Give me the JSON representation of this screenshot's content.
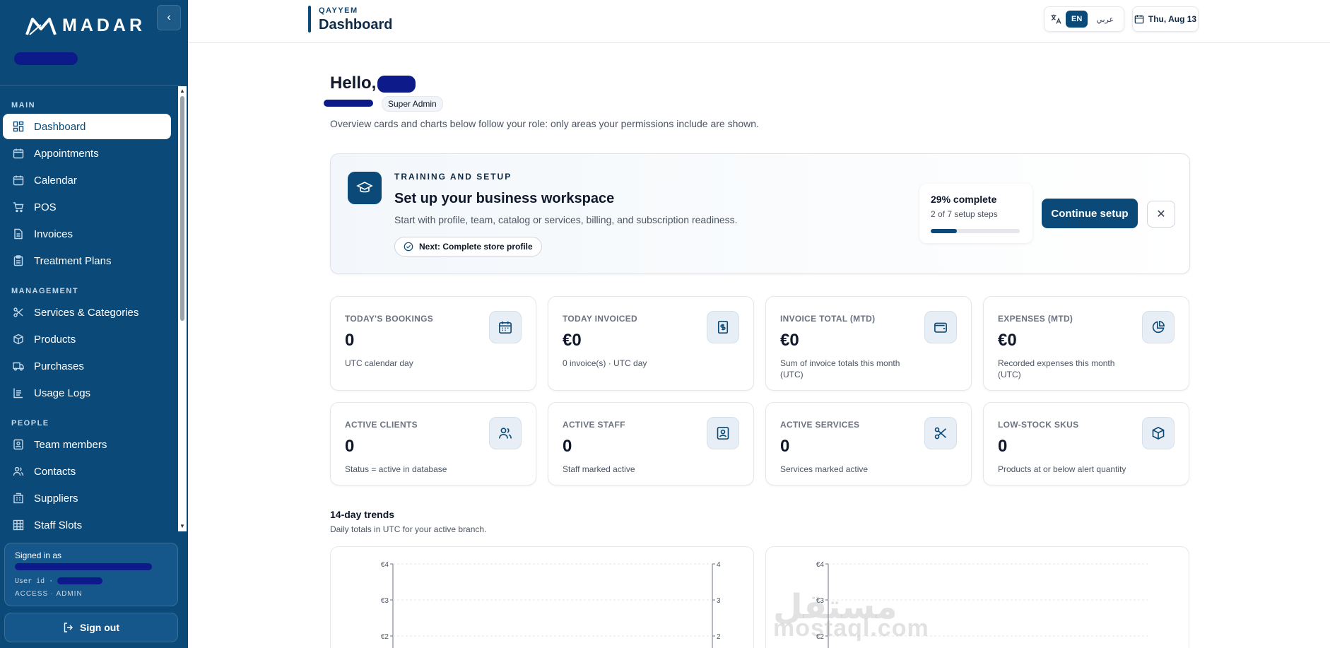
{
  "brand": {
    "logo_text": "MADAR"
  },
  "sidebar": {
    "sections": [
      {
        "label": "MAIN",
        "items": [
          {
            "label": "Dashboard",
            "icon": "dashboard-icon",
            "active": true
          },
          {
            "label": "Appointments",
            "icon": "calendar-icon"
          },
          {
            "label": "Calendar",
            "icon": "calendar-icon"
          },
          {
            "label": "POS",
            "icon": "cart-icon"
          },
          {
            "label": "Invoices",
            "icon": "file-icon"
          },
          {
            "label": "Treatment Plans",
            "icon": "clipboard-icon"
          }
        ]
      },
      {
        "label": "MANAGEMENT",
        "items": [
          {
            "label": "Services & Categories",
            "icon": "scissors-icon"
          },
          {
            "label": "Products",
            "icon": "box-icon"
          },
          {
            "label": "Purchases",
            "icon": "truck-icon"
          },
          {
            "label": "Usage Logs",
            "icon": "log-icon"
          }
        ]
      },
      {
        "label": "PEOPLE",
        "items": [
          {
            "label": "Team members",
            "icon": "id-badge-icon"
          },
          {
            "label": "Contacts",
            "icon": "users-icon"
          },
          {
            "label": "Suppliers",
            "icon": "building-icon"
          },
          {
            "label": "Staff Slots",
            "icon": "grid-icon"
          }
        ]
      }
    ],
    "signed_in": {
      "title": "Signed in as",
      "user_id_label": "User id ·",
      "access": "ACCESS · ADMIN"
    },
    "sign_out": "Sign out"
  },
  "header": {
    "brand": "QAYYEM",
    "title": "Dashboard",
    "lang_en": "EN",
    "lang_ar": "عربي",
    "date": "Thu, Aug 13"
  },
  "main": {
    "hello": "Hello,",
    "role": "Super Admin",
    "overview": "Overview cards and charts below follow your role: only areas your permissions include are shown."
  },
  "setup": {
    "eyebrow": "TRAINING AND SETUP",
    "title": "Set up your business workspace",
    "desc": "Start with profile, team, catalog or services, billing, and subscription readiness.",
    "next": "Next: Complete store profile",
    "percent_label": "29% complete",
    "progress": 0.29,
    "steps": "2 of 7 setup steps",
    "continue": "Continue setup"
  },
  "stats": [
    {
      "label": "TODAY'S BOOKINGS",
      "value": "0",
      "note": "UTC calendar day",
      "icon": "calendar-icon"
    },
    {
      "label": "TODAY INVOICED",
      "value": "€0",
      "note": "0 invoice(s) · UTC day",
      "icon": "dollar-doc-icon"
    },
    {
      "label": "INVOICE TOTAL (MTD)",
      "value": "€0",
      "note": "Sum of invoice totals this month (UTC)",
      "icon": "wallet-icon"
    },
    {
      "label": "EXPENSES (MTD)",
      "value": "€0",
      "note": "Recorded expenses this month (UTC)",
      "icon": "pie-chart-icon"
    },
    {
      "label": "ACTIVE CLIENTS",
      "value": "0",
      "note": "Status = active in database",
      "icon": "users-icon"
    },
    {
      "label": "ACTIVE STAFF",
      "value": "0",
      "note": "Staff marked active",
      "icon": "id-badge-icon"
    },
    {
      "label": "ACTIVE SERVICES",
      "value": "0",
      "note": "Services marked active",
      "icon": "scissors-icon"
    },
    {
      "label": "LOW-STOCK SKUS",
      "value": "0",
      "note": "Products at or below alert quantity",
      "icon": "box-icon"
    }
  ],
  "trends": {
    "title": "14-day trends",
    "subtitle": "Daily totals in UTC for your active branch."
  },
  "chart_data": [
    {
      "type": "line",
      "yticks_left": [
        "€4",
        "€3",
        "€2"
      ],
      "yticks_right": [
        "4",
        "3",
        "2"
      ],
      "ylim": [
        0,
        4
      ],
      "series": []
    },
    {
      "type": "line",
      "yticks_left": [
        "€4",
        "€3",
        "€2"
      ],
      "ylim": [
        0,
        4
      ],
      "series": []
    }
  ],
  "watermark": {
    "latin": "mostaql.com",
    "arabic": "مستقل"
  },
  "colors": {
    "primary": "#0b4a78",
    "accent_bg": "#e8eef5"
  }
}
